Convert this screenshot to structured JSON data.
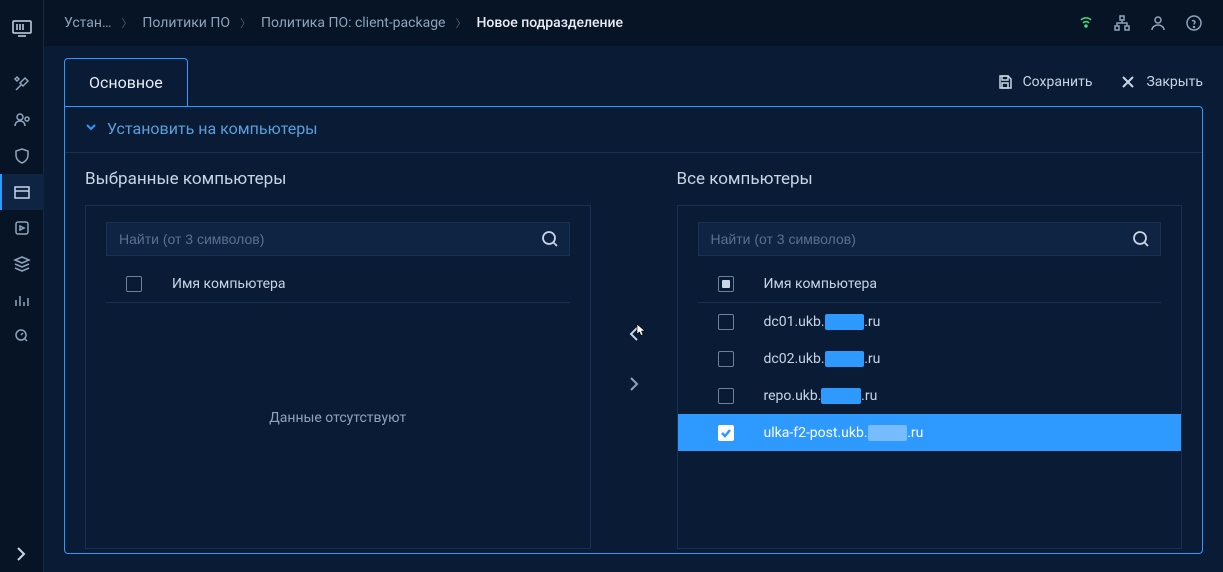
{
  "breadcrumbs": {
    "item0": "Устан…",
    "item1": "Политики ПО",
    "item2": "Политика ПО: client-package",
    "item3": "Новое подразделение"
  },
  "tabs": {
    "main": "Основное"
  },
  "actions": {
    "save": "Сохранить",
    "close": "Закрыть"
  },
  "section": {
    "title": "Установить на компьютеры"
  },
  "selected_panel": {
    "title": "Выбранные компьютеры",
    "search_placeholder": "Найти (от 3 символов)",
    "column_header": "Имя компьютера",
    "empty": "Данные отсутствуют"
  },
  "all_panel": {
    "title": "Все компьютеры",
    "search_placeholder": "Найти (от 3 символов)",
    "column_header": "Имя компьютера",
    "items": [
      {
        "prefix": "dc01.ukb.",
        "suffix": ".ru",
        "checked": false
      },
      {
        "prefix": "dc02.ukb.",
        "suffix": ".ru",
        "checked": false
      },
      {
        "prefix": "repo.ukb.",
        "suffix": ".ru",
        "checked": false
      },
      {
        "prefix": "ulka-f2-post.ukb.",
        "suffix": ".ru",
        "checked": true
      }
    ]
  }
}
